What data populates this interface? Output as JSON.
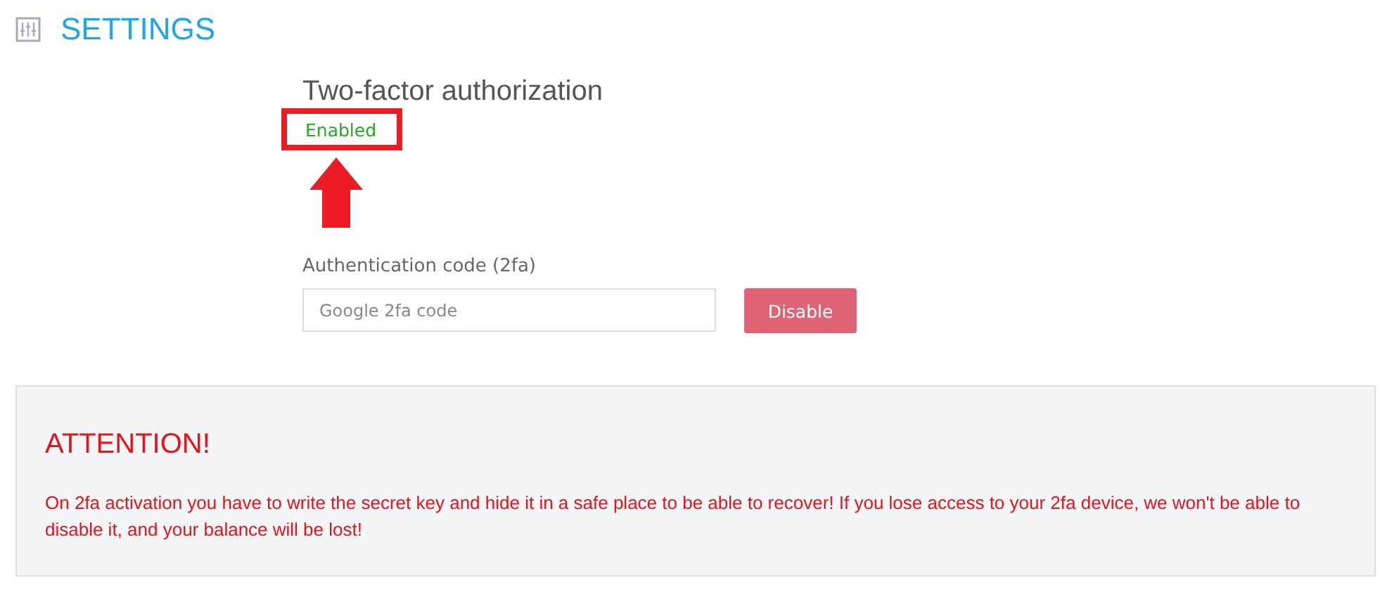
{
  "header": {
    "title": "SETTINGS"
  },
  "two_factor": {
    "title": "Two-factor authorization",
    "status": {
      "text": "Enabled",
      "enabled": true,
      "highlighted": true
    }
  },
  "form": {
    "label": "Authentication code (2fa)",
    "placeholder": "Google 2fa code",
    "button": "Disable"
  },
  "notice": {
    "title": "ATTENTION!",
    "text": "On 2fa activation you have to write the secret key and hide it in a safe place to be able to recover! If you lose access to your 2fa device, we won't be able to disable it, and your balance will be lost!"
  }
}
